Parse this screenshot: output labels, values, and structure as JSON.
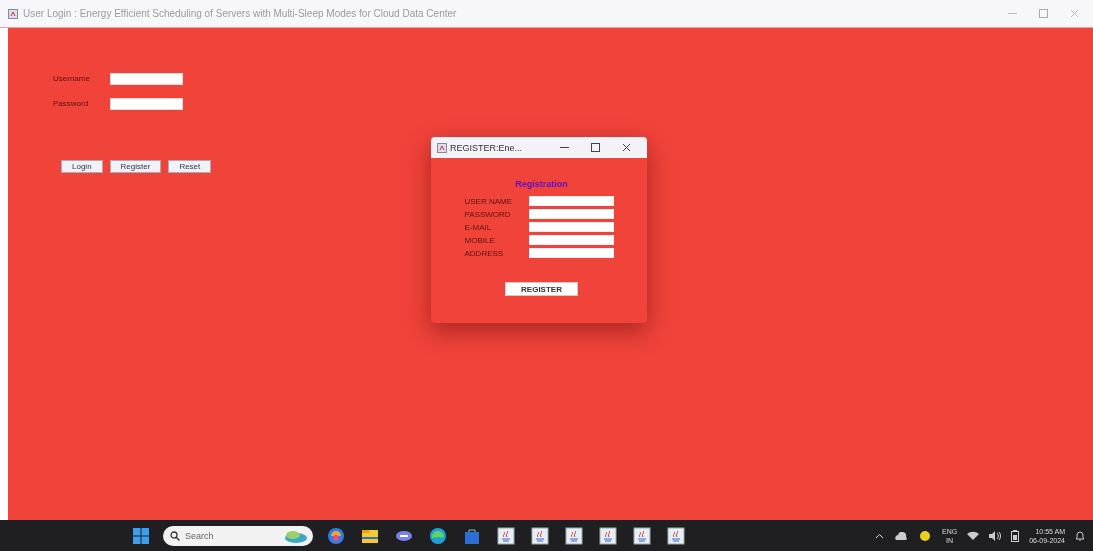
{
  "window": {
    "title": "User Login : Energy Efficient Scheduling of Servers with Multi-Sleep Modes for Cloud Data Center"
  },
  "login": {
    "fields": [
      {
        "label": "Username"
      },
      {
        "label": "Password"
      }
    ],
    "buttons": [
      "Login",
      "Register",
      "Reset"
    ]
  },
  "dialog": {
    "title": "REGISTER:Ene...",
    "heading": "Registration",
    "fields": [
      {
        "label": "USER NAME"
      },
      {
        "label": "PASSWORD"
      },
      {
        "label": "E-MAIL"
      },
      {
        "label": "MOBILE"
      },
      {
        "label": "ADDRESS"
      }
    ],
    "button": "REGISTER"
  },
  "taskbar": {
    "search": {
      "placeholder": "Search"
    },
    "apps": [
      {
        "kind": "copilot"
      },
      {
        "kind": "folder"
      },
      {
        "kind": "chat"
      },
      {
        "kind": "edge"
      },
      {
        "kind": "store"
      },
      {
        "kind": "java"
      },
      {
        "kind": "java"
      },
      {
        "kind": "java"
      },
      {
        "kind": "java"
      },
      {
        "kind": "java"
      },
      {
        "kind": "java"
      }
    ],
    "language": "ENG",
    "region": "IN",
    "time": "10:55 AM",
    "date": "06-09-2024"
  }
}
